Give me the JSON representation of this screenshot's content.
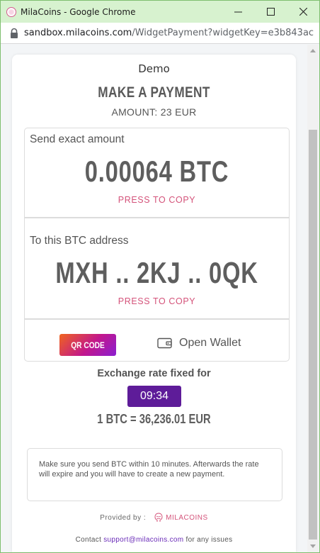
{
  "window": {
    "title": "MilaCoins - Google Chrome",
    "url_host": "sandbox.milacoins.com",
    "url_path": "/WidgetPayment?widgetKey=e3b843ac..."
  },
  "payment": {
    "merchant": "Demo",
    "heading": "MAKE A PAYMENT",
    "amount_line": "AMOUNT: 23 EUR",
    "send_label": "Send exact amount",
    "btc_amount": "0.00064 BTC",
    "copy_amount_label": "PRESS TO COPY",
    "address_label": "To this BTC address",
    "btc_address": "MXH .. 2KJ .. 0QK",
    "copy_address_label": "PRESS TO COPY",
    "qr_button_label": "QR CODE",
    "open_wallet_label": "Open Wallet",
    "rate_label": "Exchange rate fixed for",
    "timer": "09:34",
    "rate_value": "1 BTC = 36,236.01 EUR",
    "notice": "Make sure you send BTC within 10 minutes. Afterwards the rate will expire and you will have to create a new payment."
  },
  "footer": {
    "provided_by": "Provided by :",
    "brand": "MILACOINS",
    "contact_prefix": "Contact",
    "contact_email": "support@milacoins.com",
    "contact_suffix": "for any issues"
  },
  "colors": {
    "timer_bg": "#5e1c99",
    "accent_pink": "#d4537a",
    "titlebar": "#d7f2cf"
  }
}
